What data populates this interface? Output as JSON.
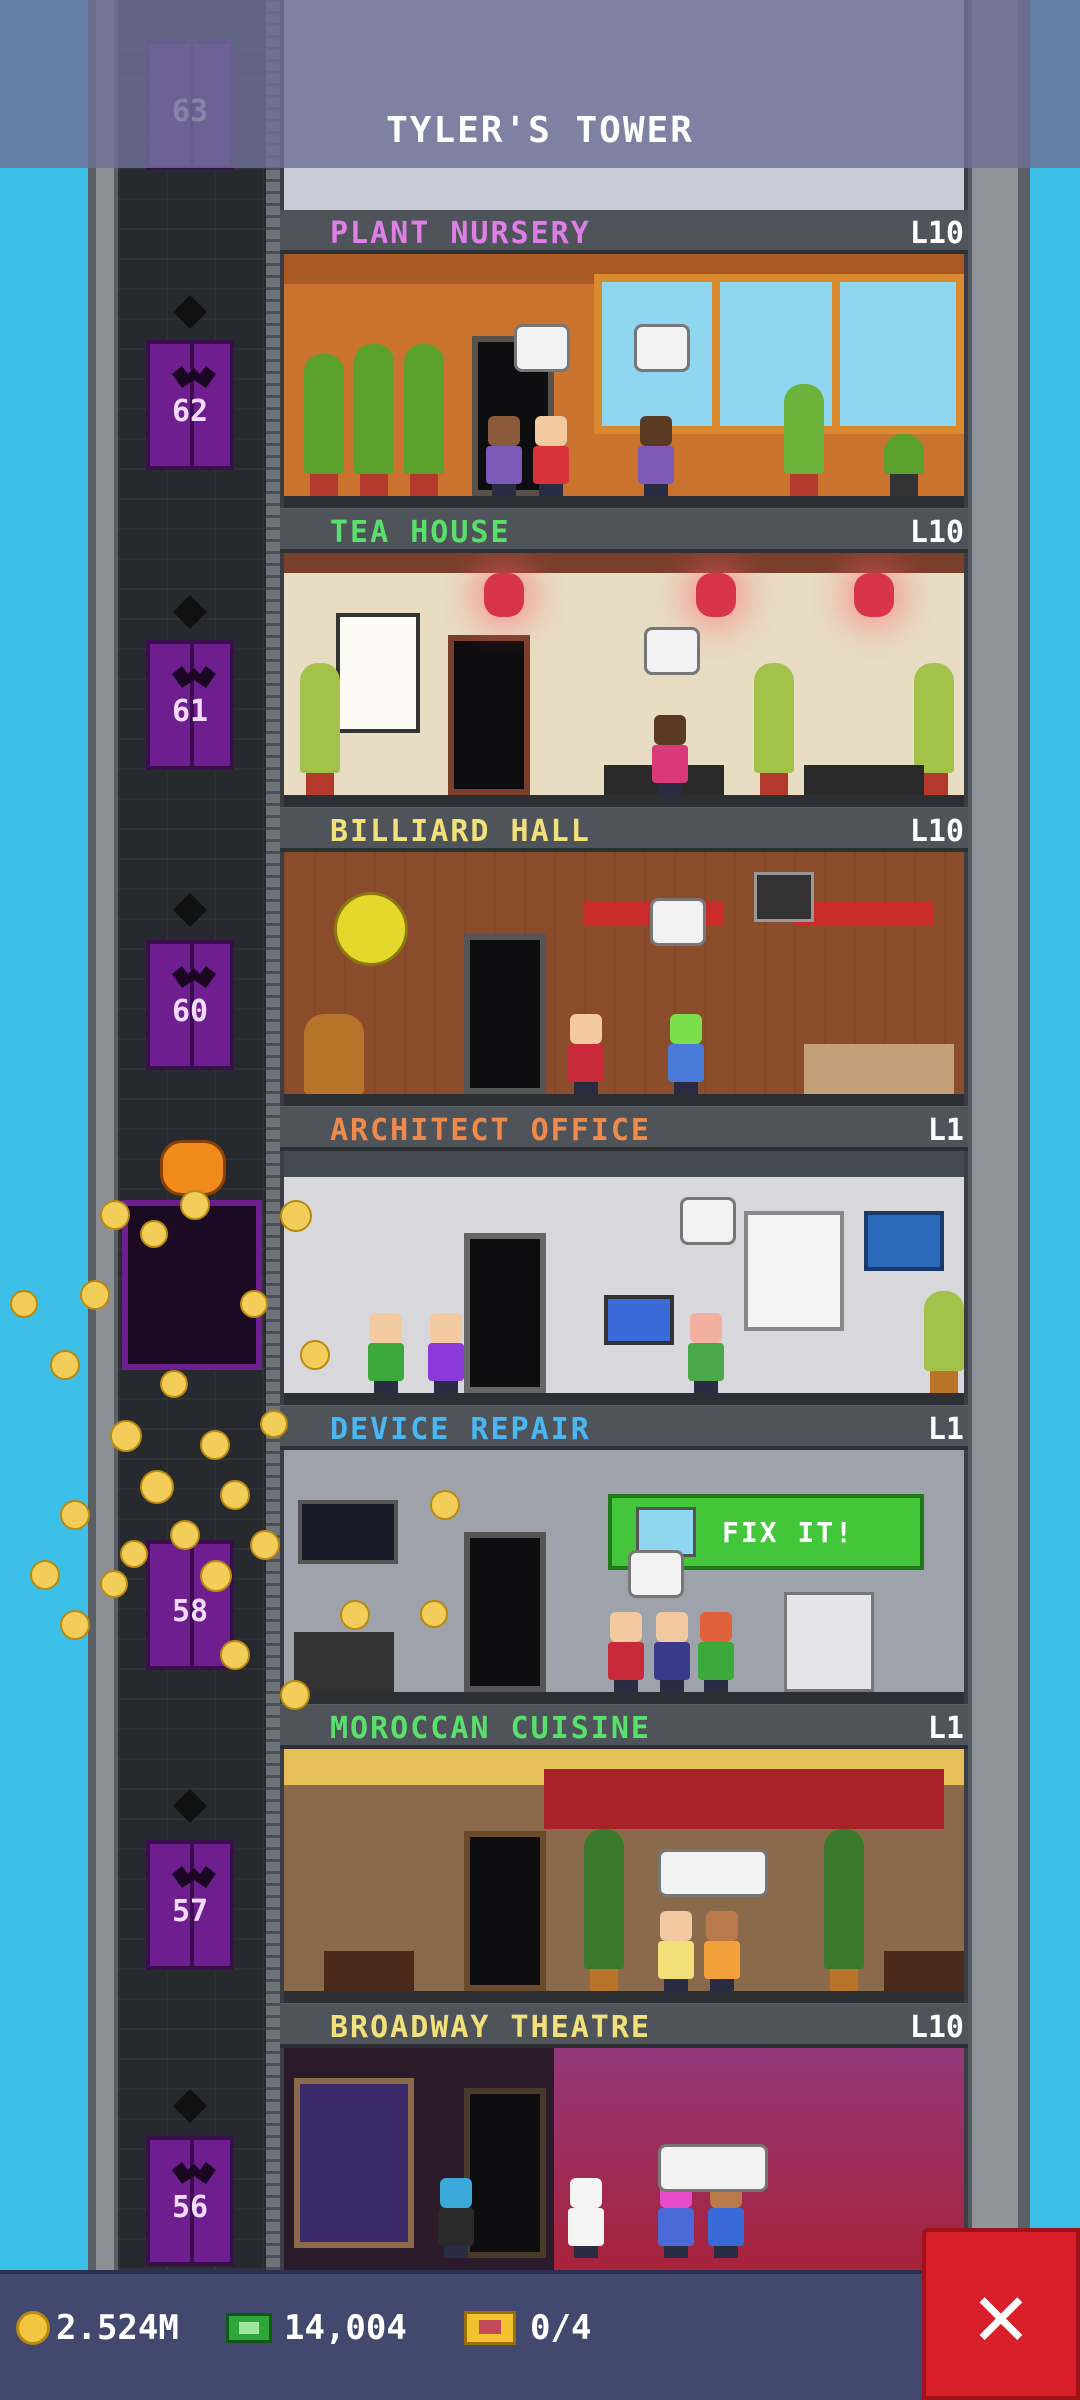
{
  "header": {
    "title": "TYLER'S TOWER"
  },
  "elevator": {
    "floors": [
      "63",
      "62",
      "61",
      "60",
      "58",
      "57",
      "56"
    ]
  },
  "floors": [
    {
      "name": "PLANT NURSERY",
      "level": "L10",
      "color": "#e07ee8"
    },
    {
      "name": "TEA HOUSE",
      "level": "L10",
      "color": "#59e06a"
    },
    {
      "name": "BILLIARD HALL",
      "level": "L10",
      "color": "#f2e07a"
    },
    {
      "name": "ARCHITECT OFFICE",
      "level": "L1",
      "color": "#f08a4a"
    },
    {
      "name": "DEVICE REPAIR",
      "level": "L1",
      "color": "#4ab7f2"
    },
    {
      "name": "MOROCCAN CUISINE",
      "level": "L1",
      "color": "#59e06a"
    },
    {
      "name": "BROADWAY THEATRE",
      "level": "L10",
      "color": "#f2e07a"
    }
  ],
  "device_repair": {
    "fix_button_label": "FIX IT!"
  },
  "resources": {
    "coins": "2.524M",
    "tower_bux": "14,004",
    "tickets": "0/4"
  },
  "icons": {
    "coin": "coin-icon",
    "bux": "tower-bux-icon",
    "ticket": "ticket-icon",
    "close": "close-icon"
  }
}
